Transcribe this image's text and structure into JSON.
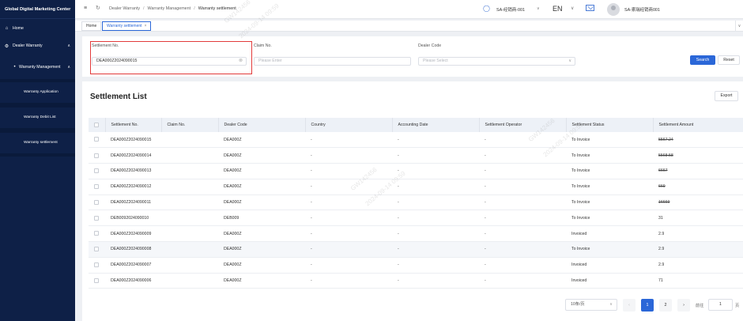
{
  "app": {
    "brand": "Global Digital Marketing Center"
  },
  "sidebar": {
    "items": [
      {
        "label": "Home",
        "icon": "home-icon"
      },
      {
        "label": "Dealer Warranty",
        "icon": "gear-icon"
      },
      {
        "label": "Warranty Management",
        "icon": "dot-icon"
      }
    ],
    "subitems": [
      "Warranty Application",
      "Warranty Debit List",
      "Warranty settlement"
    ]
  },
  "header": {
    "breadcrumb": [
      "Dealer Warranty",
      "Warranty Management",
      "Warranty settlement"
    ],
    "role": "SA-经销商-001",
    "language": "EN",
    "user": "SA-索瑞经销商001"
  },
  "tabs": [
    {
      "label": "Home"
    },
    {
      "label": "Warranty settlement"
    }
  ],
  "filters": {
    "settlement_no": {
      "label": "Settlement No.",
      "value": "DEA000Z2024090015"
    },
    "claim_no": {
      "label": "Claim No.",
      "placeholder": "Please Enter"
    },
    "dealer_code": {
      "label": "Dealer Code",
      "placeholder": "Please Select"
    },
    "search_label": "Search",
    "reset_label": "Reset"
  },
  "list": {
    "title": "Settlement List",
    "export_label": "Export",
    "columns": [
      "Settlement No.",
      "Claim No.",
      "Dealer Code",
      "Country",
      "Accounting Date",
      "Settlement Operator",
      "Settlement Status",
      "Settlement Amount"
    ],
    "rows": [
      {
        "settlement_no": "DEA000Z2024090015",
        "claim_no": "",
        "dealer_code": "DEA000Z",
        "country": "-",
        "accounting_date": "-",
        "operator": "-",
        "status": "To Invoice",
        "amount": "5567.24",
        "struck": true
      },
      {
        "settlement_no": "DEA000Z2024090014",
        "claim_no": "",
        "dealer_code": "DEA000Z",
        "country": "-",
        "accounting_date": "-",
        "operator": "-",
        "status": "To Invoice",
        "amount": "5568.58",
        "struck": true
      },
      {
        "settlement_no": "DEA000Z2024090013",
        "claim_no": "",
        "dealer_code": "DEA000Z",
        "country": "-",
        "accounting_date": "-",
        "operator": "-",
        "status": "To Invoice",
        "amount": "6667",
        "struck": true
      },
      {
        "settlement_no": "DEA000Z2024090012",
        "claim_no": "",
        "dealer_code": "DEA000Z",
        "country": "-",
        "accounting_date": "-",
        "operator": "-",
        "status": "To Invoice",
        "amount": "669",
        "struck": true
      },
      {
        "settlement_no": "DEA000Z2024090011",
        "claim_no": "",
        "dealer_code": "DEA000Z",
        "country": "-",
        "accounting_date": "-",
        "operator": "-",
        "status": "To Invoice",
        "amount": "16669",
        "struck": true
      },
      {
        "settlement_no": "DEB0092024090010",
        "claim_no": "",
        "dealer_code": "DEB009",
        "country": "-",
        "accounting_date": "-",
        "operator": "-",
        "status": "To Invoice",
        "amount": "31",
        "struck": false
      },
      {
        "settlement_no": "DEA000Z2024090009",
        "claim_no": "",
        "dealer_code": "DEA000Z",
        "country": "-",
        "accounting_date": "-",
        "operator": "-",
        "status": "Invoiced",
        "amount": "2.9",
        "struck": false
      },
      {
        "settlement_no": "DEA000Z2024090008",
        "claim_no": "",
        "dealer_code": "DEA000Z",
        "country": "-",
        "accounting_date": "-",
        "operator": "-",
        "status": "To Invoice",
        "amount": "2.9",
        "struck": false
      },
      {
        "settlement_no": "DEA000Z2024090007",
        "claim_no": "",
        "dealer_code": "DEA000Z",
        "country": "-",
        "accounting_date": "-",
        "operator": "-",
        "status": "Invoiced",
        "amount": "2.9",
        "struck": false
      },
      {
        "settlement_no": "DEA000Z2024090006",
        "claim_no": "",
        "dealer_code": "DEA000Z",
        "country": "-",
        "accounting_date": "-",
        "operator": "-",
        "status": "Invoiced",
        "amount": "71",
        "struck": false
      }
    ]
  },
  "pagination": {
    "page_size": "10条/页",
    "pages": [
      "1",
      "2"
    ],
    "current": "1",
    "goto_label": "前往",
    "goto_value": "1",
    "goto_suffix": "页"
  },
  "watermark": [
    "GW142456",
    "2024-09-14 09:59"
  ],
  "colors": {
    "sidebar": "#0e2047",
    "accent": "#2b67d8",
    "highlight": "#e23b3b"
  }
}
